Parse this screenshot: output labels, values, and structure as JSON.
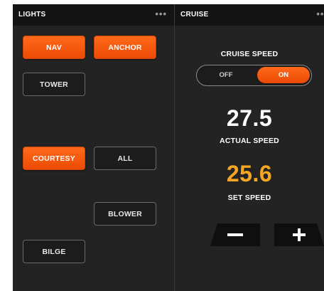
{
  "lights": {
    "title": "LIGHTS",
    "menu": "•••",
    "buttons": {
      "nav": "NAV",
      "anchor": "ANCHOR",
      "tower": "TOWER",
      "courtesy": "COURTESY",
      "all": "ALL",
      "blower": "BLOWER",
      "bilge": "BILGE"
    }
  },
  "cruise": {
    "title": "CRUISE",
    "menu": "•••",
    "cruise_speed_label": "CRUISE SPEED",
    "toggle": {
      "off": "OFF",
      "on": "ON",
      "state": "ON"
    },
    "actual_speed": "27.5",
    "actual_speed_label": "ACTUAL SPEED",
    "set_speed": "25.6",
    "set_speed_label": "SET SPEED",
    "minus_icon": "minus-icon",
    "plus_icon": "plus-icon"
  },
  "colors": {
    "accent": "#f25a0e",
    "set_speed": "#f5a623",
    "panel_bg": "#232323",
    "header_bg": "#141414"
  }
}
